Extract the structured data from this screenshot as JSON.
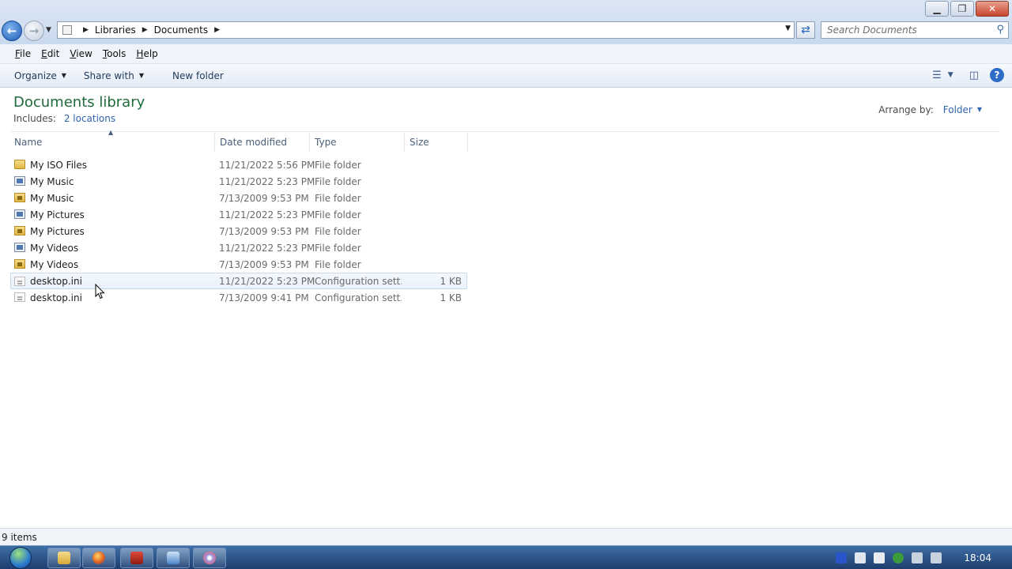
{
  "window": {
    "minimize": "▁",
    "maximize": "❐",
    "close": "✕"
  },
  "nav": {
    "back_icon": "arrow-left-icon",
    "forward_icon": "arrow-right-icon"
  },
  "address": {
    "crumbs": [
      "Libraries",
      "Documents"
    ]
  },
  "search": {
    "placeholder": "Search Documents"
  },
  "menu": {
    "items": [
      "File",
      "Edit",
      "View",
      "Tools",
      "Help"
    ]
  },
  "commands": {
    "organize": "Organize",
    "share_with": "Share with",
    "new_folder": "New folder"
  },
  "library": {
    "title": "Documents library",
    "includes_label": "Includes:",
    "includes_link": "2 locations",
    "arrange_label": "Arrange by:",
    "arrange_value": "Folder"
  },
  "columns": {
    "name": "Name",
    "date": "Date modified",
    "type": "Type",
    "size": "Size"
  },
  "files": [
    {
      "name": "My ISO Files",
      "date": "11/21/2022 5:56 PM",
      "type": "File folder",
      "size": "",
      "icon": "folder-icon"
    },
    {
      "name": "My Music",
      "date": "11/21/2022 5:23 PM",
      "type": "File folder",
      "size": "",
      "icon": "shortcut-folder-icon"
    },
    {
      "name": "My Music",
      "date": "7/13/2009 9:53 PM",
      "type": "File folder",
      "size": "",
      "icon": "locked-folder-icon"
    },
    {
      "name": "My Pictures",
      "date": "11/21/2022 5:23 PM",
      "type": "File folder",
      "size": "",
      "icon": "shortcut-folder-icon"
    },
    {
      "name": "My Pictures",
      "date": "7/13/2009 9:53 PM",
      "type": "File folder",
      "size": "",
      "icon": "locked-folder-icon"
    },
    {
      "name": "My Videos",
      "date": "11/21/2022 5:23 PM",
      "type": "File folder",
      "size": "",
      "icon": "shortcut-folder-icon"
    },
    {
      "name": "My Videos",
      "date": "7/13/2009 9:53 PM",
      "type": "File folder",
      "size": "",
      "icon": "locked-folder-icon"
    },
    {
      "name": "desktop.ini",
      "date": "11/21/2022 5:23 PM",
      "type": "Configuration sett...",
      "size": "1 KB",
      "icon": "ini-file-icon"
    },
    {
      "name": "desktop.ini",
      "date": "7/13/2009 9:41 PM",
      "type": "Configuration sett...",
      "size": "1 KB",
      "icon": "ini-file-icon"
    }
  ],
  "status": {
    "items_text": "9 items"
  },
  "taskbar": {
    "clock": "18:04"
  }
}
